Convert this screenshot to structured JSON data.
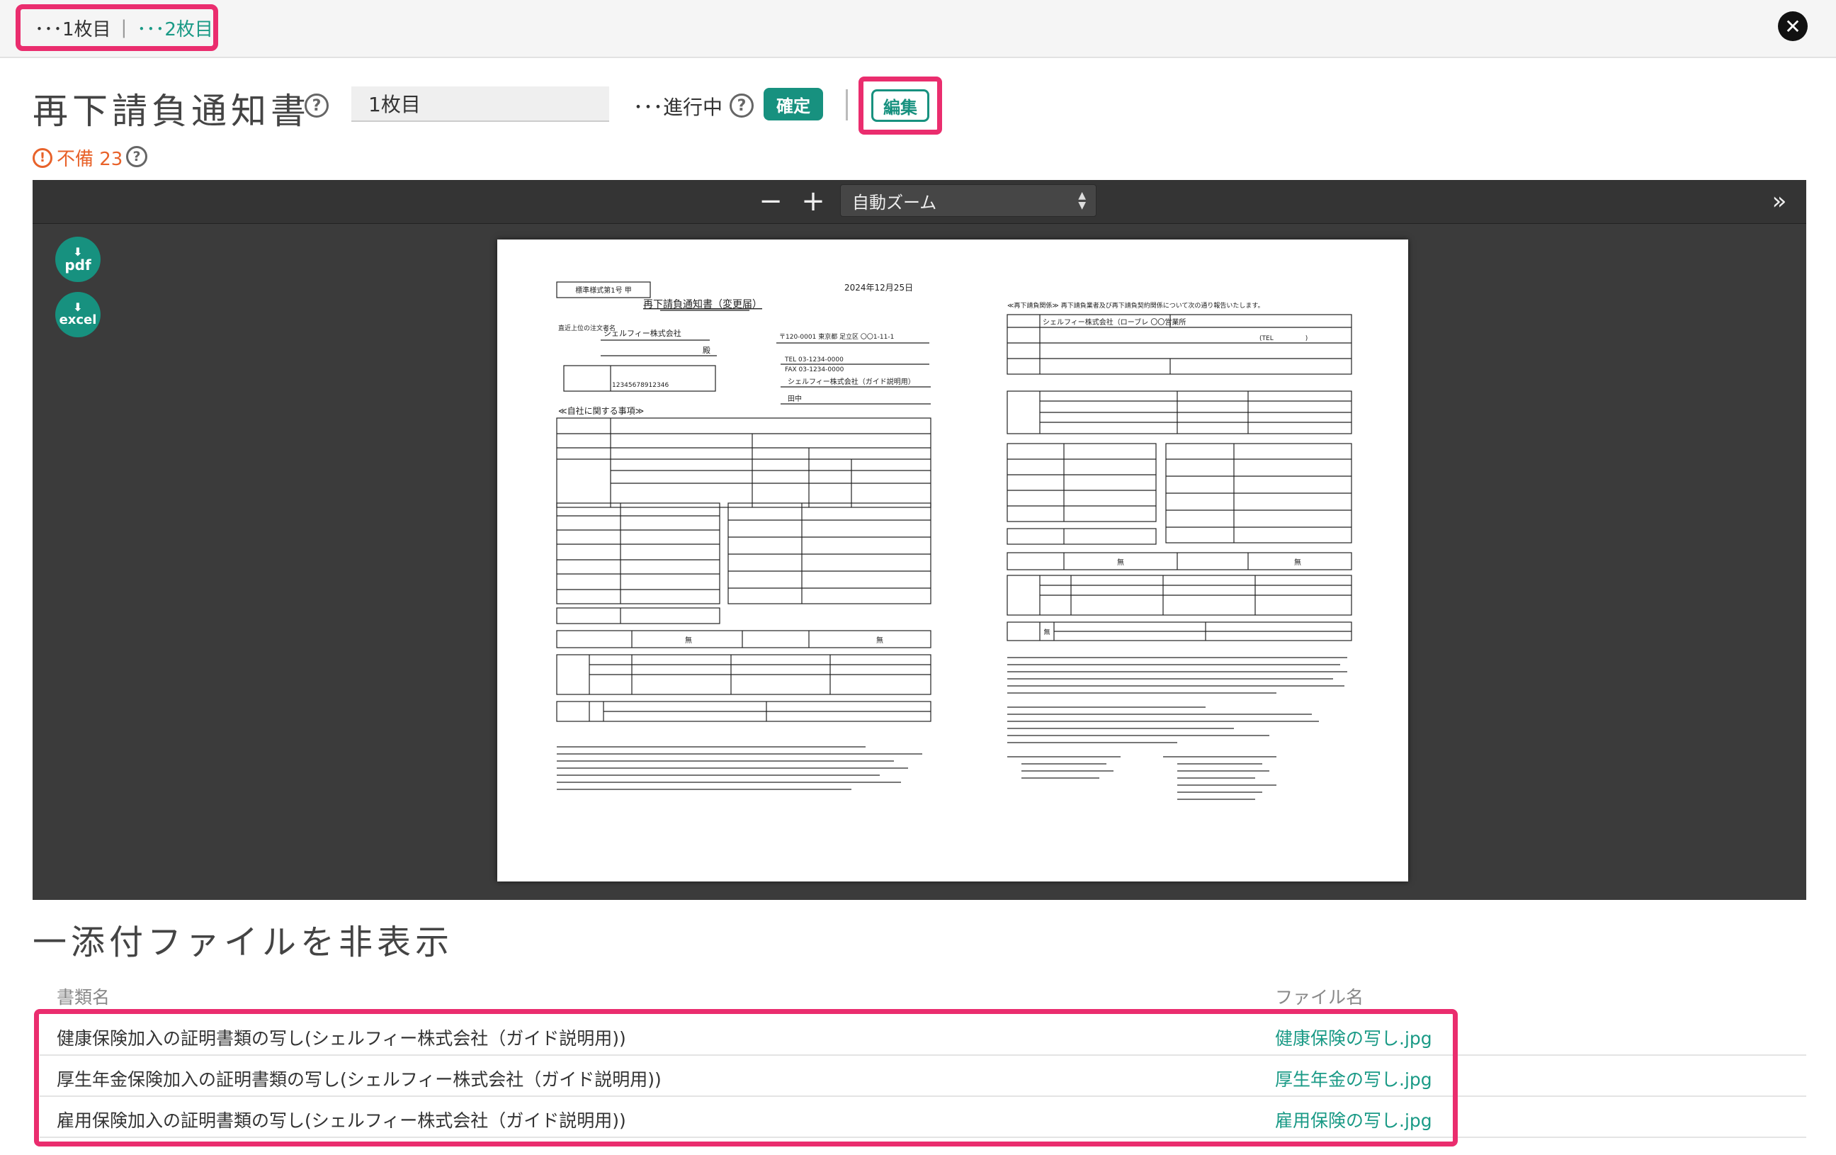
{
  "top_tabs": {
    "sheet1": "･･･1枚目",
    "separator": "|",
    "sheet2": "･･･2枚目"
  },
  "header": {
    "title": "再下請負通知書",
    "help": "?",
    "sheet_name_value": "1枚目",
    "status": "･･･進行中",
    "confirm_label": "確定",
    "edit_label": "編集"
  },
  "warning": {
    "icon": "!",
    "text": "不備 23"
  },
  "viewer": {
    "zoom_out": "−",
    "zoom_in": "+",
    "zoom_select": "自動ズーム",
    "sidebar_toggle": "»",
    "download_pdf": "pdf",
    "download_excel": "excel"
  },
  "document": {
    "form_no": "標準様式第1号 甲",
    "date": "2024年12月25日",
    "title": "再下請負通知書（変更届）",
    "client_label": "直近上位の注文者名",
    "client": "シェルフィー株式会社",
    "honorific": "殿",
    "section_self": "≪自社に関する事項≫",
    "company": "シェルフィー株式会社（ガイド説明用）",
    "address": "〒120-0001 東京都 足立区 〇〇1-11-1",
    "tel": "TEL 03-1234-0000",
    "fax": "FAX 03-1234-0000",
    "representative": "田中",
    "contractor_id": "12345678912346",
    "none1": "無",
    "none2": "無",
    "right_title": "≪再下請負関係≫ 再下請負業者及び再下請負契約関係について次の通り報告いたします。",
    "right_company": "シェルフィー株式会社（ローブレ 〇〇営業所",
    "right_tel": "(TEL　　　　　)",
    "none3": "無",
    "none4": "無",
    "none5": "無"
  },
  "attachments": {
    "toggle_label": "一添付ファイルを非表示",
    "col_name": "書類名",
    "col_file": "ファイル名",
    "rows": [
      {
        "name": "健康保険加入の証明書類の写し(シェルフィー株式会社（ガイド説明用))",
        "file": "健康保険の写し.jpg"
      },
      {
        "name": "厚生年金保険加入の証明書類の写し(シェルフィー株式会社（ガイド説明用))",
        "file": "厚生年金の写し.jpg"
      },
      {
        "name": "雇用保険加入の証明書類の写し(シェルフィー株式会社（ガイド説明用))",
        "file": "雇用保険の写し.jpg"
      }
    ]
  },
  "colors": {
    "accent": "#17917f",
    "highlight": "#ea2d6e",
    "warning": "#e8622a"
  }
}
